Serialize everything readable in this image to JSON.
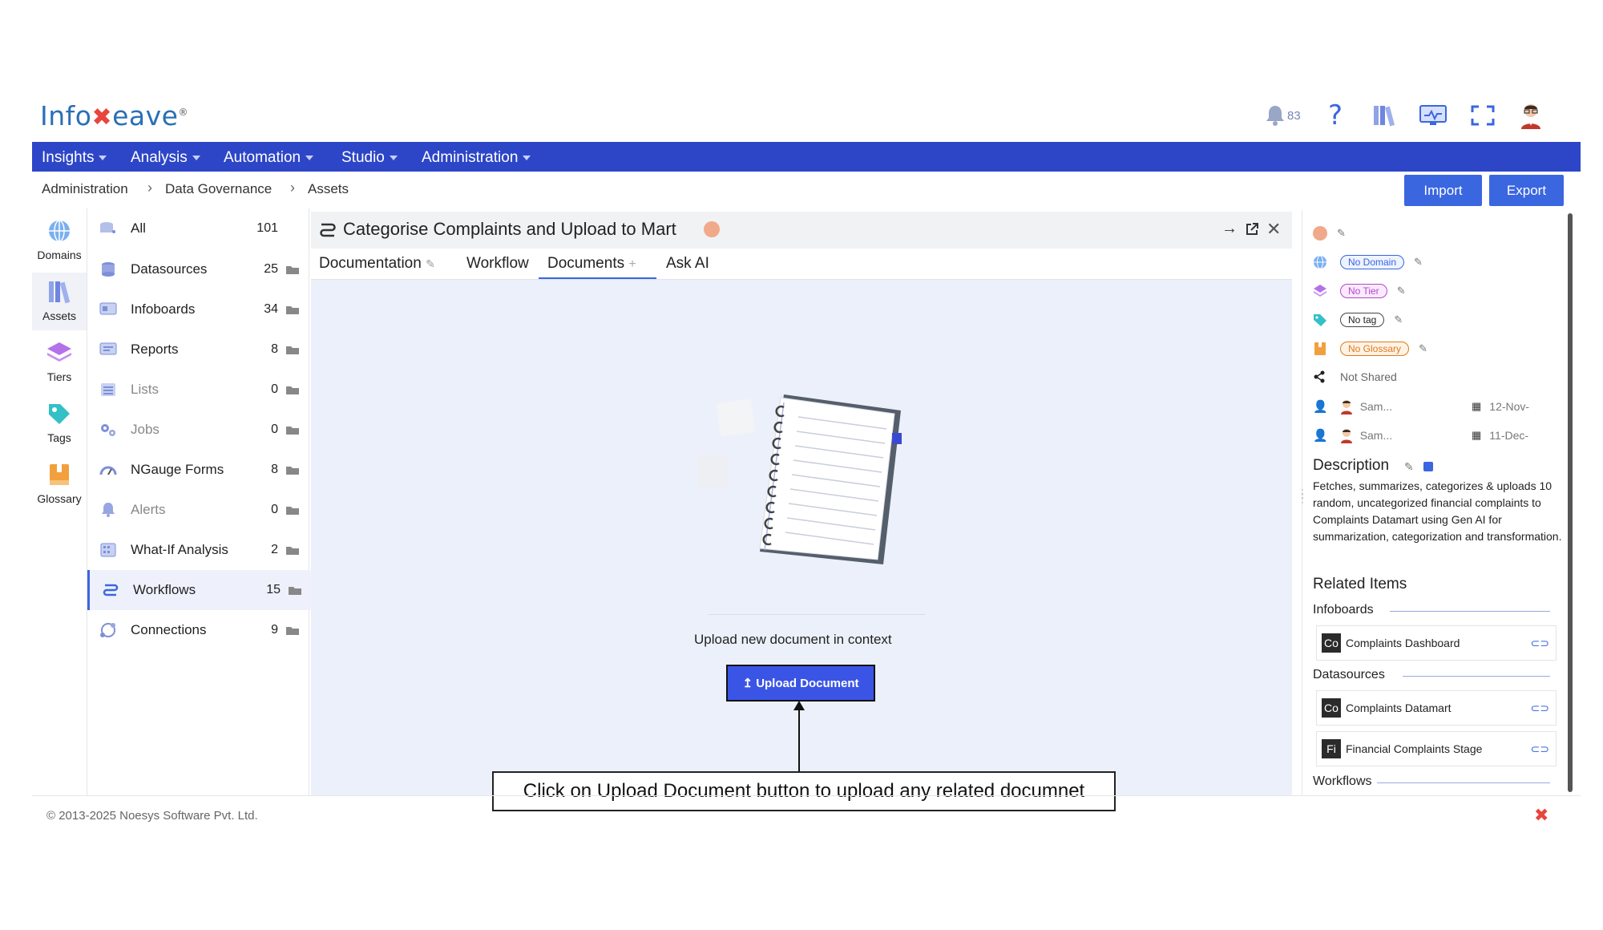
{
  "brand": {
    "name_left": "Info",
    "name_right": "eave",
    "tm": "®"
  },
  "header": {
    "notification_count": "83"
  },
  "nav": [
    {
      "label": "Insights"
    },
    {
      "label": "Analysis"
    },
    {
      "label": "Automation"
    },
    {
      "label": "Studio"
    },
    {
      "label": "Administration"
    }
  ],
  "breadcrumb": [
    "Administration",
    "Data Governance",
    "Assets"
  ],
  "actions": {
    "import": "Import",
    "export": "Export"
  },
  "rail": [
    {
      "label": "Domains",
      "icon": "globe-icon"
    },
    {
      "label": "Assets",
      "icon": "books-icon"
    },
    {
      "label": "Tiers",
      "icon": "layers-icon"
    },
    {
      "label": "Tags",
      "icon": "tag-icon"
    },
    {
      "label": "Glossary",
      "icon": "book-icon"
    }
  ],
  "assets": [
    {
      "label": "All",
      "count": "101"
    },
    {
      "label": "Datasources",
      "count": "25"
    },
    {
      "label": "Infoboards",
      "count": "34"
    },
    {
      "label": "Reports",
      "count": "8"
    },
    {
      "label": "Lists",
      "count": "0"
    },
    {
      "label": "Jobs",
      "count": "0"
    },
    {
      "label": "NGauge Forms",
      "count": "8"
    },
    {
      "label": "Alerts",
      "count": "0"
    },
    {
      "label": "What-If Analysis",
      "count": "2"
    },
    {
      "label": "Workflows",
      "count": "15"
    },
    {
      "label": "Connections",
      "count": "9"
    }
  ],
  "panel": {
    "title": "Categorise Complaints and Upload to Mart",
    "tabs": [
      "Documentation",
      "Workflow",
      "Documents",
      "Ask AI"
    ],
    "upload_prompt": "Upload new document in context",
    "upload_button": "↥ Upload Document"
  },
  "callout": "Click on Upload Document button to upload any related documnet",
  "details": {
    "domain": "No Domain",
    "tier": "No Tier",
    "tag": "No tag",
    "glossary": "No Glossary",
    "shared": "Not Shared",
    "created_by": "Sam...",
    "created_on": "12-Nov-",
    "modified_by": "Sam...",
    "modified_on": "11-Dec-",
    "description_title": "Description",
    "description": "Fetches, summarizes, categorizes & uploads 10 random, uncategorized financial complaints to Complaints Datamart using Gen AI for summarization, categorization and transformation.",
    "related_title": "Related Items",
    "sections": {
      "infoboards": "Infoboards",
      "datasources": "Datasources",
      "workflows": "Workflows"
    },
    "related": {
      "infoboards": [
        {
          "badge": "Co",
          "name": "Complaints Dashboard"
        }
      ],
      "datasources": [
        {
          "badge": "Co",
          "name": "Complaints Datamart"
        },
        {
          "badge": "Fi",
          "name": "Financial Complaints Stage"
        }
      ]
    }
  },
  "footer": "© 2013-2025 Noesys Software Pvt. Ltd.",
  "colors": {
    "nav": "#2d46c8",
    "accent": "#3a66e0",
    "content_bg": "#ecf0fa"
  }
}
